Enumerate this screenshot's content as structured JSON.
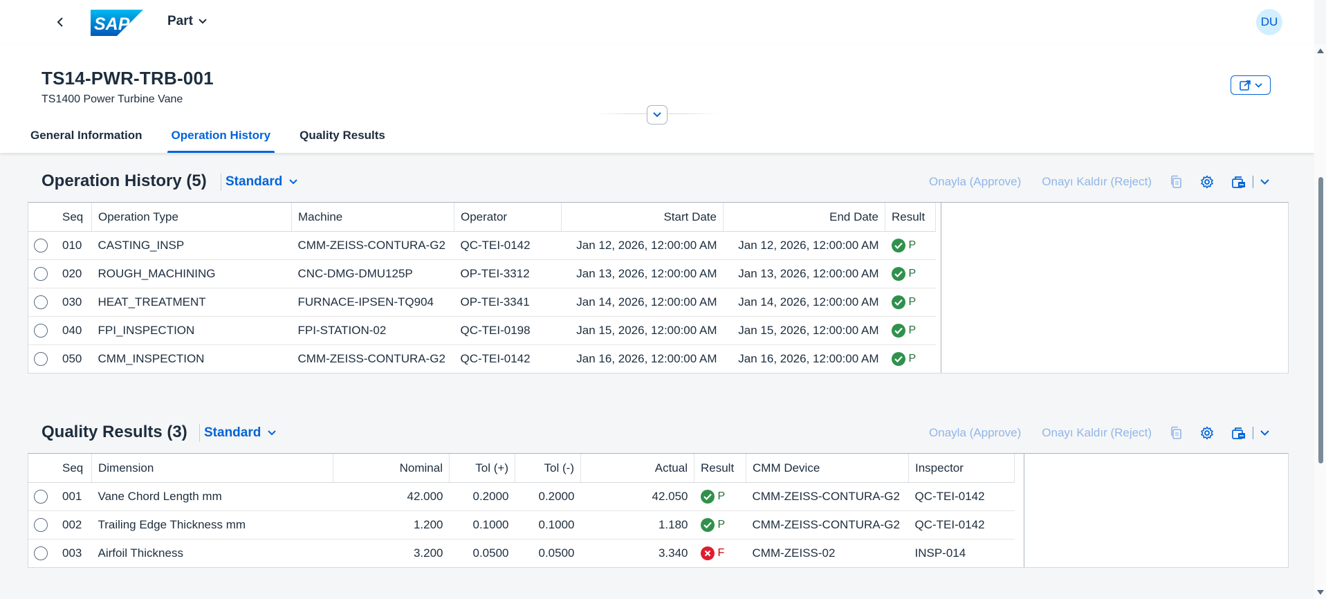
{
  "shell": {
    "app_title": "Part",
    "avatar_initials": "DU",
    "logo_text": "SAP"
  },
  "header": {
    "title": "TS14-PWR-TRB-001",
    "subtitle": "TS1400 Power Turbine Vane"
  },
  "tabs": [
    {
      "label": "General Information"
    },
    {
      "label": "Operation History"
    },
    {
      "label": "Quality Results"
    }
  ],
  "active_tab": "Operation History",
  "toolbar": {
    "approve_label": "Onayla (Approve)",
    "reject_label": "Onayı Kaldır (Reject)"
  },
  "operation_history": {
    "title": "Operation History (5)",
    "variant": "Standard",
    "columns": [
      "Seq",
      "Operation Type",
      "Machine",
      "Operator",
      "Start Date",
      "End Date",
      "Result"
    ],
    "rows": [
      {
        "seq": "010",
        "type": "CASTING_INSP",
        "machine": "CMM-ZEISS-CONTURA-G2",
        "operator": "QC-TEI-0142",
        "start": "Jan 12, 2026, 12:00:00 AM",
        "end": "Jan 12, 2026, 12:00:00 AM",
        "result": "P"
      },
      {
        "seq": "020",
        "type": "ROUGH_MACHINING",
        "machine": "CNC-DMG-DMU125P",
        "operator": "OP-TEI-3312",
        "start": "Jan 13, 2026, 12:00:00 AM",
        "end": "Jan 13, 2026, 12:00:00 AM",
        "result": "P"
      },
      {
        "seq": "030",
        "type": "HEAT_TREATMENT",
        "machine": "FURNACE-IPSEN-TQ904",
        "operator": "OP-TEI-3341",
        "start": "Jan 14, 2026, 12:00:00 AM",
        "end": "Jan 14, 2026, 12:00:00 AM",
        "result": "P"
      },
      {
        "seq": "040",
        "type": "FPI_INSPECTION",
        "machine": "FPI-STATION-02",
        "operator": "QC-TEI-0198",
        "start": "Jan 15, 2026, 12:00:00 AM",
        "end": "Jan 15, 2026, 12:00:00 AM",
        "result": "P"
      },
      {
        "seq": "050",
        "type": "CMM_INSPECTION",
        "machine": "CMM-ZEISS-CONTURA-G2",
        "operator": "QC-TEI-0142",
        "start": "Jan 16, 2026, 12:00:00 AM",
        "end": "Jan 16, 2026, 12:00:00 AM",
        "result": "P"
      }
    ]
  },
  "quality_results": {
    "title": "Quality Results (3)",
    "variant": "Standard",
    "columns": [
      "Seq",
      "Dimension",
      "Nominal",
      "Tol (+)",
      "Tol (-)",
      "Actual",
      "Result",
      "CMM Device",
      "Inspector"
    ],
    "rows": [
      {
        "seq": "001",
        "dimension": "Vane Chord Length mm",
        "nominal": "42.000",
        "tol_plus": "0.2000",
        "tol_minus": "0.2000",
        "actual": "42.050",
        "result": "P",
        "device": "CMM-ZEISS-CONTURA-G2",
        "inspector": "QC-TEI-0142"
      },
      {
        "seq": "002",
        "dimension": "Trailing Edge Thickness mm",
        "nominal": "1.200",
        "tol_plus": "0.1000",
        "tol_minus": "0.1000",
        "actual": "1.180",
        "result": "P",
        "device": "CMM-ZEISS-CONTURA-G2",
        "inspector": "QC-TEI-0142"
      },
      {
        "seq": "003",
        "dimension": "Airfoil Thickness",
        "nominal": "3.200",
        "tol_plus": "0.0500",
        "tol_minus": "0.0500",
        "actual": "3.340",
        "result": "F",
        "device": "CMM-ZEISS-02",
        "inspector": "INSP-014"
      }
    ]
  },
  "colors": {
    "brand": "#0064d9",
    "pass": "#30914c",
    "fail": "#e01c2e",
    "disabled_text": "#8fb6ea"
  },
  "icons": {
    "back": "chevron-left-icon",
    "share": "share-icon",
    "collapse": "chevron-down-icon",
    "copy": "copy-icon",
    "settings": "gear-icon",
    "export": "export-icon",
    "pass": "check-circle-icon",
    "fail": "error-circle-icon"
  }
}
